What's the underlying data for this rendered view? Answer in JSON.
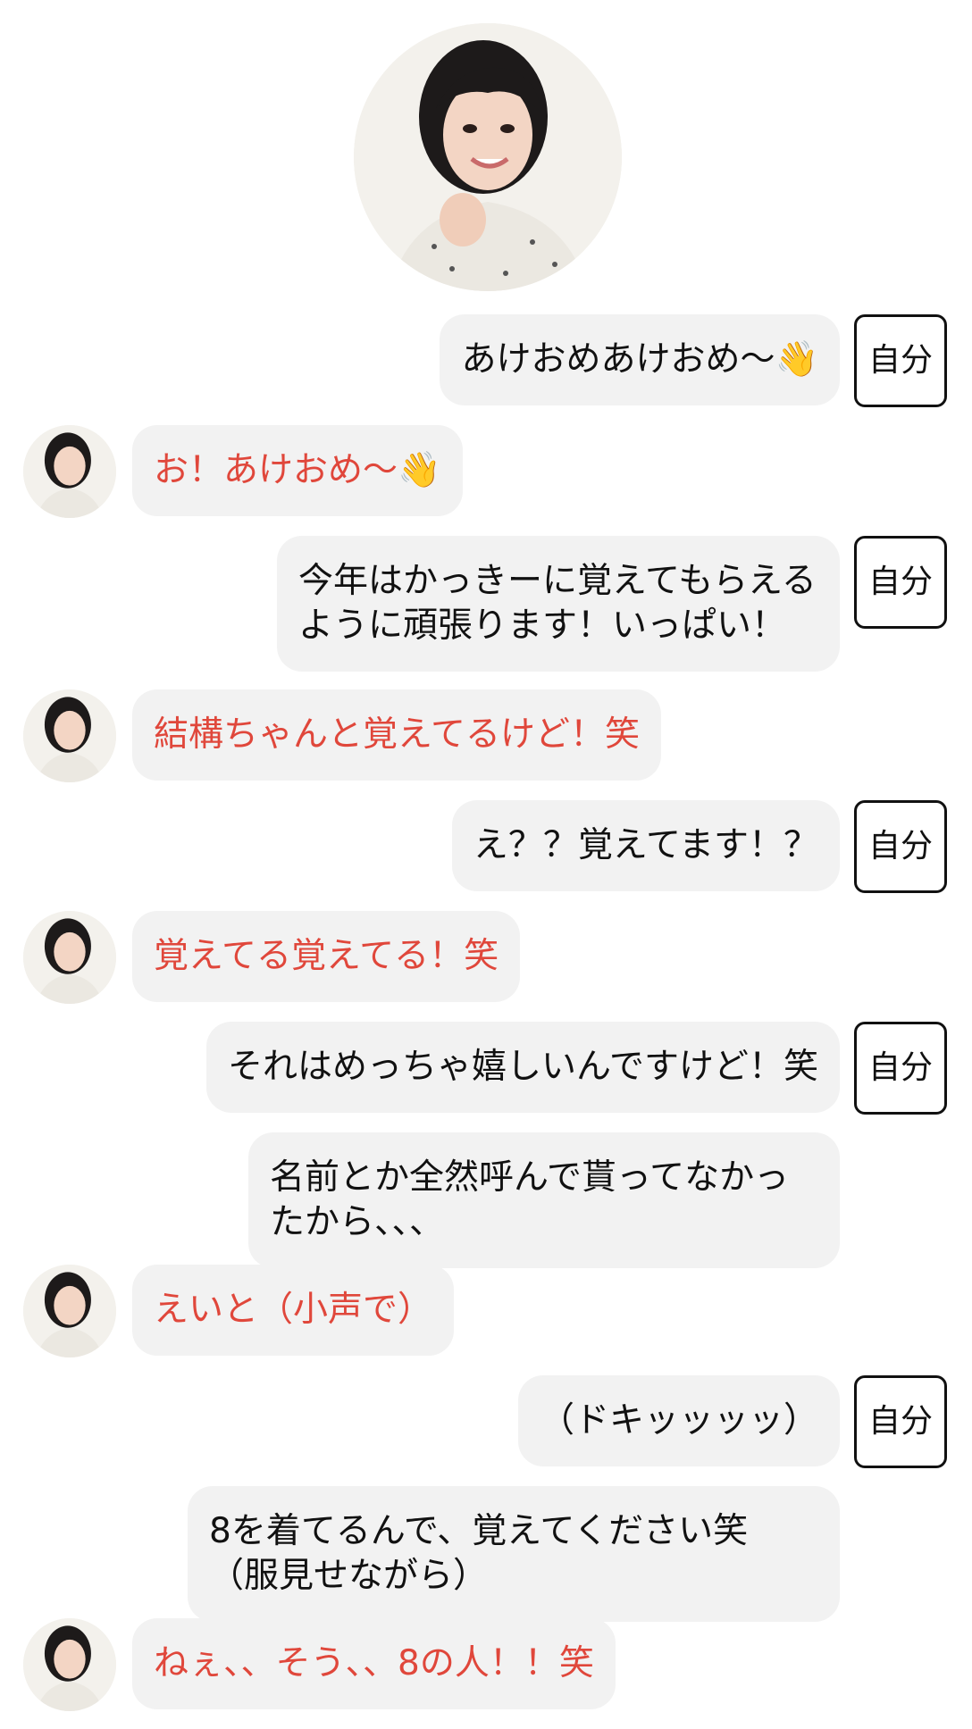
{
  "messages": [
    {
      "type": "sent",
      "text": "あけおめあけおめ〜👋",
      "tag": "自分"
    },
    {
      "type": "recv",
      "text": "お！あけおめ〜👋"
    },
    {
      "type": "sent",
      "text": "今年はかっきーに覚えてもらえるように頑張ります！いっぱい！",
      "tag": "自分"
    },
    {
      "type": "recv",
      "text": "結構ちゃんと覚えてるけど！笑"
    },
    {
      "type": "sent",
      "text": "え？？覚えてます！？",
      "tag": "自分"
    },
    {
      "type": "recv",
      "text": "覚えてる覚えてる！笑"
    },
    {
      "type": "sent",
      "text": "それはめっちゃ嬉しいんですけど！笑",
      "tag": "自分"
    },
    {
      "type": "sent",
      "text": "名前とか全然呼んで貰ってなかったから、、、",
      "tag": ""
    },
    {
      "type": "recv",
      "text": "えいと（小声で）"
    },
    {
      "type": "sent",
      "text": "（ドキッッッッ）",
      "tag": "自分"
    },
    {
      "type": "sent",
      "text": "8を着てるんで、覚えてください笑\n（服見せながら）",
      "tag": ""
    },
    {
      "type": "recv",
      "text": "ねぇ、、そう、、8の人！！笑"
    }
  ],
  "colors": {
    "bubble_bg": "#f2f2f2",
    "sent_text": "#111111",
    "recv_text": "#e0473b"
  },
  "icons": {
    "avatar": "avatar-photo",
    "wave": "waving-hand-emoji"
  }
}
